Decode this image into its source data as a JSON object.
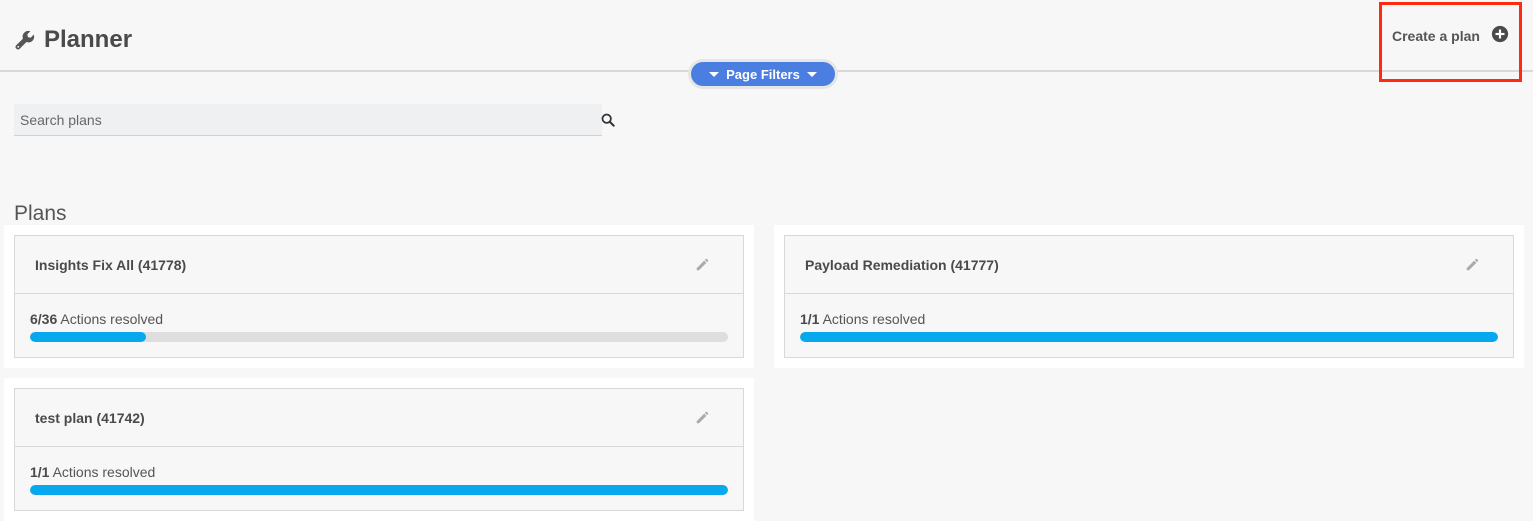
{
  "header": {
    "title": "Planner",
    "create_label": "Create a plan",
    "filters_label": "Page Filters"
  },
  "search": {
    "placeholder": "Search plans",
    "value": ""
  },
  "plans_section": {
    "title": "Plans"
  },
  "plans": [
    {
      "name": "Insights Fix All (41778)",
      "resolved": 6,
      "total": 36,
      "fraction": "6/36",
      "suffix": "Actions resolved"
    },
    {
      "name": "Payload Remediation (41777)",
      "resolved": 1,
      "total": 1,
      "fraction": "1/1",
      "suffix": "Actions resolved"
    },
    {
      "name": "test plan (41742)",
      "resolved": 1,
      "total": 1,
      "fraction": "1/1",
      "suffix": "Actions resolved"
    }
  ],
  "colors": {
    "accent": "#4a7ee0",
    "progress": "#06a8ee",
    "highlight": "#ff2a12"
  },
  "icons": {
    "title": "wrench-icon",
    "create": "plus-circle-icon",
    "search": "search-icon",
    "edit": "pencil-icon"
  }
}
